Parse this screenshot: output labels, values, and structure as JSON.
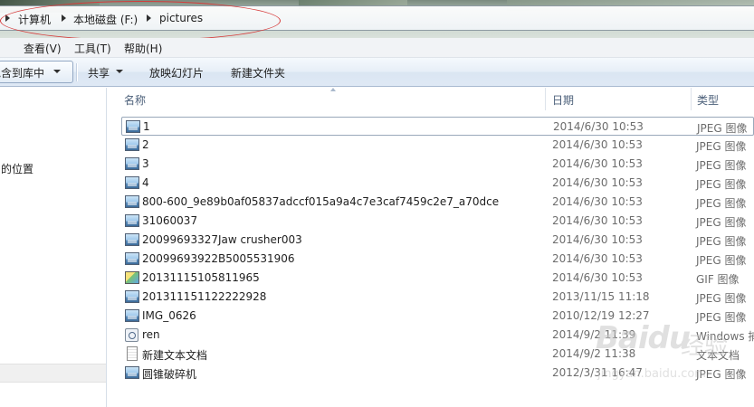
{
  "address_bar": {
    "crumbs": [
      "计算机",
      "本地磁盘 (F:)",
      "pictures"
    ]
  },
  "menu": {
    "items": [
      "查看(V)",
      "工具(T)",
      "帮助(H)"
    ]
  },
  "toolbar": {
    "include_label": "包含到库中",
    "share_label": "共享",
    "slideshow_label": "放映幻灯片",
    "new_folder_label": "新建文件夹"
  },
  "nav": {
    "partial_label": "问的位置"
  },
  "columns": {
    "name": "名称",
    "date": "日期",
    "type": "类型"
  },
  "files": [
    {
      "name": "1",
      "date": "2014/6/30 10:53",
      "type": "JPEG 图像",
      "icon": "image-file-icon"
    },
    {
      "name": "2",
      "date": "2014/6/30 10:53",
      "type": "JPEG 图像",
      "icon": "image-file-icon"
    },
    {
      "name": "3",
      "date": "2014/6/30 10:53",
      "type": "JPEG 图像",
      "icon": "image-file-icon"
    },
    {
      "name": "4",
      "date": "2014/6/30 10:53",
      "type": "JPEG 图像",
      "icon": "image-file-icon"
    },
    {
      "name": "800-600_9e89b0af05837adccf015a9a4c7e3caf7459c2e7_a70dce",
      "date": "2014/6/30 10:53",
      "type": "JPEG 图像",
      "icon": "image-file-icon"
    },
    {
      "name": "31060037",
      "date": "2014/6/30 10:53",
      "type": "JPEG 图像",
      "icon": "image-file-icon"
    },
    {
      "name": "20099693327Jaw crusher003",
      "date": "2014/6/30 10:53",
      "type": "JPEG 图像",
      "icon": "image-file-icon"
    },
    {
      "name": "20099693922B5005531906",
      "date": "2014/6/30 10:53",
      "type": "JPEG 图像",
      "icon": "image-file-icon"
    },
    {
      "name": "20131115105811965",
      "date": "2014/6/30 10:53",
      "type": "GIF 图像",
      "icon": "gif-file-icon"
    },
    {
      "name": "201311151122222928",
      "date": "2013/11/15 11:18",
      "type": "JPEG 图像",
      "icon": "image-file-icon"
    },
    {
      "name": "IMG_0626",
      "date": "2010/12/19 12:27",
      "type": "JPEG 图像",
      "icon": "image-file-icon"
    },
    {
      "name": "ren",
      "date": "2014/9/2 11:39",
      "type": "Windows 捕",
      "icon": "windows-file-icon"
    },
    {
      "name": "新建文本文档",
      "date": "2014/9/2 11:38",
      "type": "文本文档",
      "icon": "text-file-icon"
    },
    {
      "name": "圆锥破碎机",
      "date": "2012/3/31 16:47",
      "type": "JPEG 图像",
      "icon": "image-file-icon"
    }
  ],
  "watermark": {
    "brand": "Baidu",
    "cn": "经验",
    "url": "jingyan.baidu.com"
  }
}
